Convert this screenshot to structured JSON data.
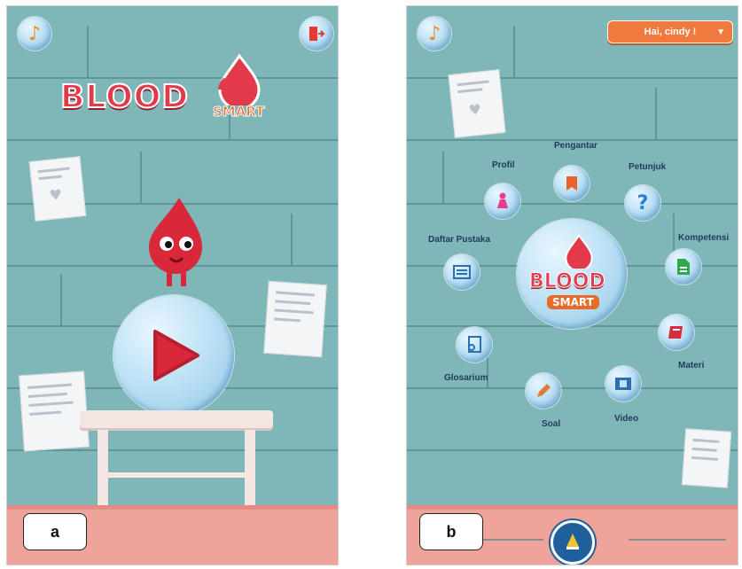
{
  "screen_a": {
    "label": "a",
    "logo": {
      "main": "BLOOD",
      "sub": "SMART"
    },
    "icons": {
      "music": "music-note-icon",
      "exit": "exit-door-icon",
      "play": "play-icon"
    }
  },
  "screen_b": {
    "label": "b",
    "greeting": "Hai, cindy !",
    "center_logo": {
      "main": "BLOOD",
      "sub": "SMART"
    },
    "menu": [
      {
        "label": "Pengantar",
        "icon": "bookmark-icon",
        "color": "#e8632b"
      },
      {
        "label": "Petunjuk",
        "icon": "question-icon",
        "color": "#2a7fd4"
      },
      {
        "label": "Kompetensi",
        "icon": "document-icon",
        "color": "#2fa84f"
      },
      {
        "label": "Materi",
        "icon": "book-icon",
        "color": "#d92c3a"
      },
      {
        "label": "Video",
        "icon": "film-icon",
        "color": "#2a6fb3"
      },
      {
        "label": "Soal",
        "icon": "pencil-icon",
        "color": "#e07a3a"
      },
      {
        "label": "Glosarium",
        "icon": "search-document-icon",
        "color": "#2a6fb3"
      },
      {
        "label": "Daftar Pustaka",
        "icon": "list-icon",
        "color": "#2a6fb3"
      },
      {
        "label": "Profil",
        "icon": "person-icon",
        "color": "#e83d8c"
      }
    ]
  },
  "colors": {
    "wall": "#7fb6b8",
    "floor": "#f0a39b",
    "accent": "#f07a3e",
    "brand_red": "#d8283a"
  }
}
